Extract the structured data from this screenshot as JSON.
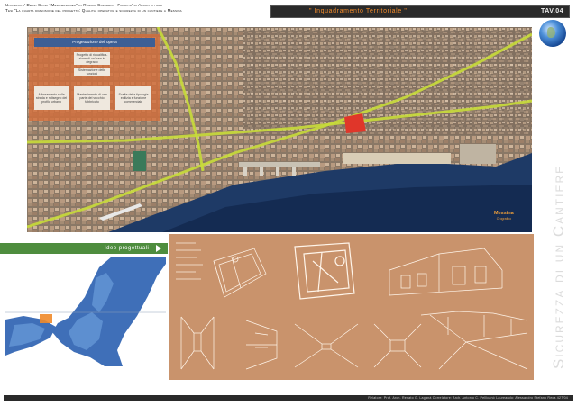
{
  "header": {
    "line1": "Universita' Degli Studi \"Mediterranea\" di Reggio Calabria - Facolta' di Architettura",
    "line2": "Tesi \"La quarta dimensione del progetto: Qualita' operativa e sicurezza di un cantiere a Messina"
  },
  "title_bar": {
    "title": "\" Inquadramento Territoriale \"",
    "sheet": "TAV.04"
  },
  "sidebar": {
    "header": "Progettazione dell'opera",
    "box1": "Progetto di riqualifica-zione di un'area in degrado",
    "box2": "Sistemazione delle funzioni",
    "box3": "Allineamento sulla strada e ridisegno del profilo urbano",
    "box4": "Mantenimento di una parte del vecchio fabbricato",
    "box5": "Scelta della tipologia edilizia e funzione commerciale"
  },
  "map": {
    "label": "Messina",
    "sublabel": "Orografico"
  },
  "ideas": {
    "label": "Idee progettuali"
  },
  "vertical_title": "Sicurezza di un Cantiere",
  "footer": {
    "text": "Relatore: Prof. Arch. Renato G. Laganà  Correlatore: Arch. Antonio C. Pellicanò  Laureando: Alessandro Stefano Reca  427/04"
  },
  "colors": {
    "accent_orange": "#f08a2a",
    "panel_orange": "#c9936c",
    "green_bar": "#4e8d3e",
    "road_yellow": "#c8dc3a",
    "highlight_red": "#e0362a"
  }
}
